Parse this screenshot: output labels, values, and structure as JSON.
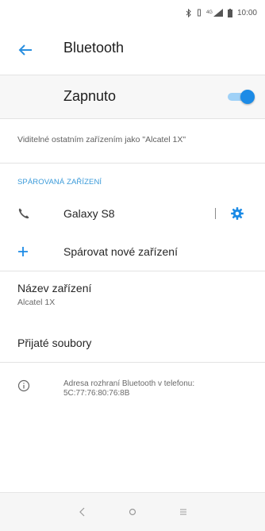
{
  "status_bar": {
    "icons": [
      "bluetooth-icon",
      "vibrate-icon",
      "signal-icon",
      "battery-icon"
    ],
    "network_label": "4G",
    "time": "10:00"
  },
  "app_bar": {
    "back_icon": "arrow-left-icon",
    "title": "Bluetooth"
  },
  "master_switch": {
    "label": "Zapnuto",
    "state": "on",
    "accent": "#1c8be6"
  },
  "visibility_note": "Viditelné ostatním zařízením jako \"Alcatel 1X\"",
  "paired_section": {
    "header": "SPÁROVANÁ ZAŘÍZENÍ",
    "devices": [
      {
        "name": "Galaxy S8",
        "icon": "phone-icon",
        "settings_icon": "gear-icon"
      }
    ]
  },
  "pair_new": {
    "icon": "plus-icon",
    "label": "Spárovat nové zařízení"
  },
  "device_name": {
    "title": "Název zařízení",
    "value": "Alcatel 1X"
  },
  "received_files": {
    "label": "Přijaté soubory"
  },
  "info": {
    "icon": "info-icon",
    "text_line1": "Adresa rozhraní Bluetooth v telefonu:",
    "text_line2": "5C:77:76:80:76:8B"
  },
  "nav_bar": {
    "buttons": [
      "back-nav-icon",
      "home-nav-icon",
      "recents-nav-icon"
    ]
  },
  "colors": {
    "accent_blue": "#1c8be6",
    "section_header": "#3a9ad9"
  }
}
